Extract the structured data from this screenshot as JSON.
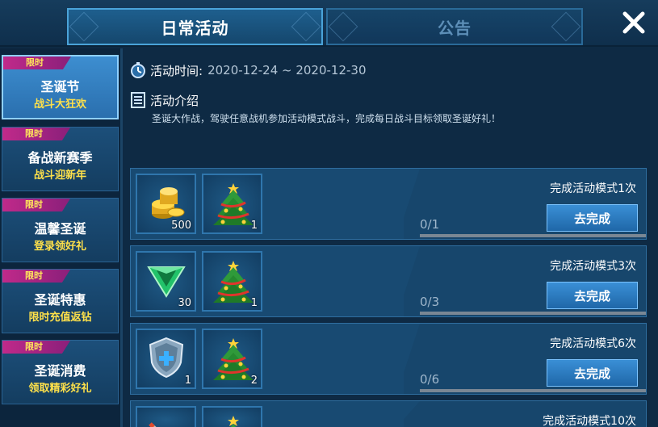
{
  "header": {
    "tabs": [
      {
        "label": "日常活动",
        "active": true
      },
      {
        "label": "公告",
        "active": false
      }
    ]
  },
  "sidebar": {
    "items": [
      {
        "tag": "限时",
        "title": "圣诞节",
        "subtitle": "战斗大狂欢",
        "active": true
      },
      {
        "tag": "限时",
        "title": "备战新赛季",
        "subtitle": "战斗迎新年",
        "active": false
      },
      {
        "tag": "限时",
        "title": "温馨圣诞",
        "subtitle": "登录领好礼",
        "active": false
      },
      {
        "tag": "限时",
        "title": "圣诞特惠",
        "subtitle": "限时充值返钻",
        "active": false
      },
      {
        "tag": "限时",
        "title": "圣诞消费",
        "subtitle": "领取精彩好礼",
        "active": false
      }
    ]
  },
  "activity": {
    "time_label": "活动时间:",
    "time_value": "2020-12-24 ~ 2020-12-30",
    "intro_label": "活动介绍",
    "intro_text": "圣诞大作战，驾驶任意战机参加活动模式战斗，完成每日战斗目标领取圣诞好礼！"
  },
  "tasks": [
    {
      "description": "完成活动模式1次",
      "progress_text": "0/1",
      "progress": 0,
      "button_label": "去完成",
      "rewards": [
        {
          "icon": "gold-coins-icon",
          "qty": "500"
        },
        {
          "icon": "christmas-tree-icon",
          "qty": "1"
        }
      ]
    },
    {
      "description": "完成活动模式3次",
      "progress_text": "0/3",
      "progress": 0,
      "button_label": "去完成",
      "rewards": [
        {
          "icon": "green-gem-icon",
          "qty": "30"
        },
        {
          "icon": "christmas-tree-icon",
          "qty": "1"
        }
      ]
    },
    {
      "description": "完成活动模式6次",
      "progress_text": "0/6",
      "progress": 0,
      "button_label": "去完成",
      "rewards": [
        {
          "icon": "repair-shield-icon",
          "qty": "1"
        },
        {
          "icon": "christmas-tree-icon",
          "qty": "2"
        }
      ]
    },
    {
      "description": "完成活动模式10次",
      "rewards": [
        {
          "icon": "missile-icon",
          "qty": ""
        },
        {
          "icon": "christmas-tree-icon",
          "qty": ""
        }
      ]
    }
  ],
  "colors": {
    "accent": "#3a8fd6",
    "tag": "#c02a8a",
    "highlight": "#ffe14a"
  }
}
